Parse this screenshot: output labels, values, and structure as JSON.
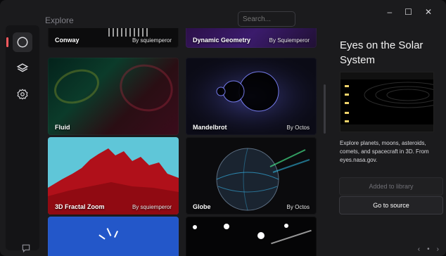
{
  "window": {
    "title": "Explore",
    "search_placeholder": "Search..."
  },
  "controls": {
    "minimize": "–",
    "maximize": "☐",
    "close": "✕"
  },
  "rail": {
    "items": [
      {
        "name": "explore",
        "icon": "compass-icon"
      },
      {
        "name": "library",
        "icon": "layers-icon"
      },
      {
        "name": "settings",
        "icon": "gear-icon"
      }
    ]
  },
  "cards": [
    {
      "title": "Conway",
      "author": "By squiemperor"
    },
    {
      "title": "Dynamic Geometry",
      "author": "By Squiemperor"
    },
    {
      "title": "Fluid",
      "author": ""
    },
    {
      "title": "Mandelbrot",
      "author": "By Octos"
    },
    {
      "title": "3D Fractal Zoom",
      "author": "By squiemperor"
    },
    {
      "title": "Globe",
      "author": "By Octos"
    },
    {
      "title": "",
      "author": ""
    },
    {
      "title": "",
      "author": ""
    }
  ],
  "detail": {
    "title": "Eyes on the Solar System",
    "description": "Explore planets, moons, asteroids, comets, and spacecraft in 3D. From eyes.nasa.gov.",
    "added_label": "Added to library",
    "source_label": "Go to source"
  }
}
